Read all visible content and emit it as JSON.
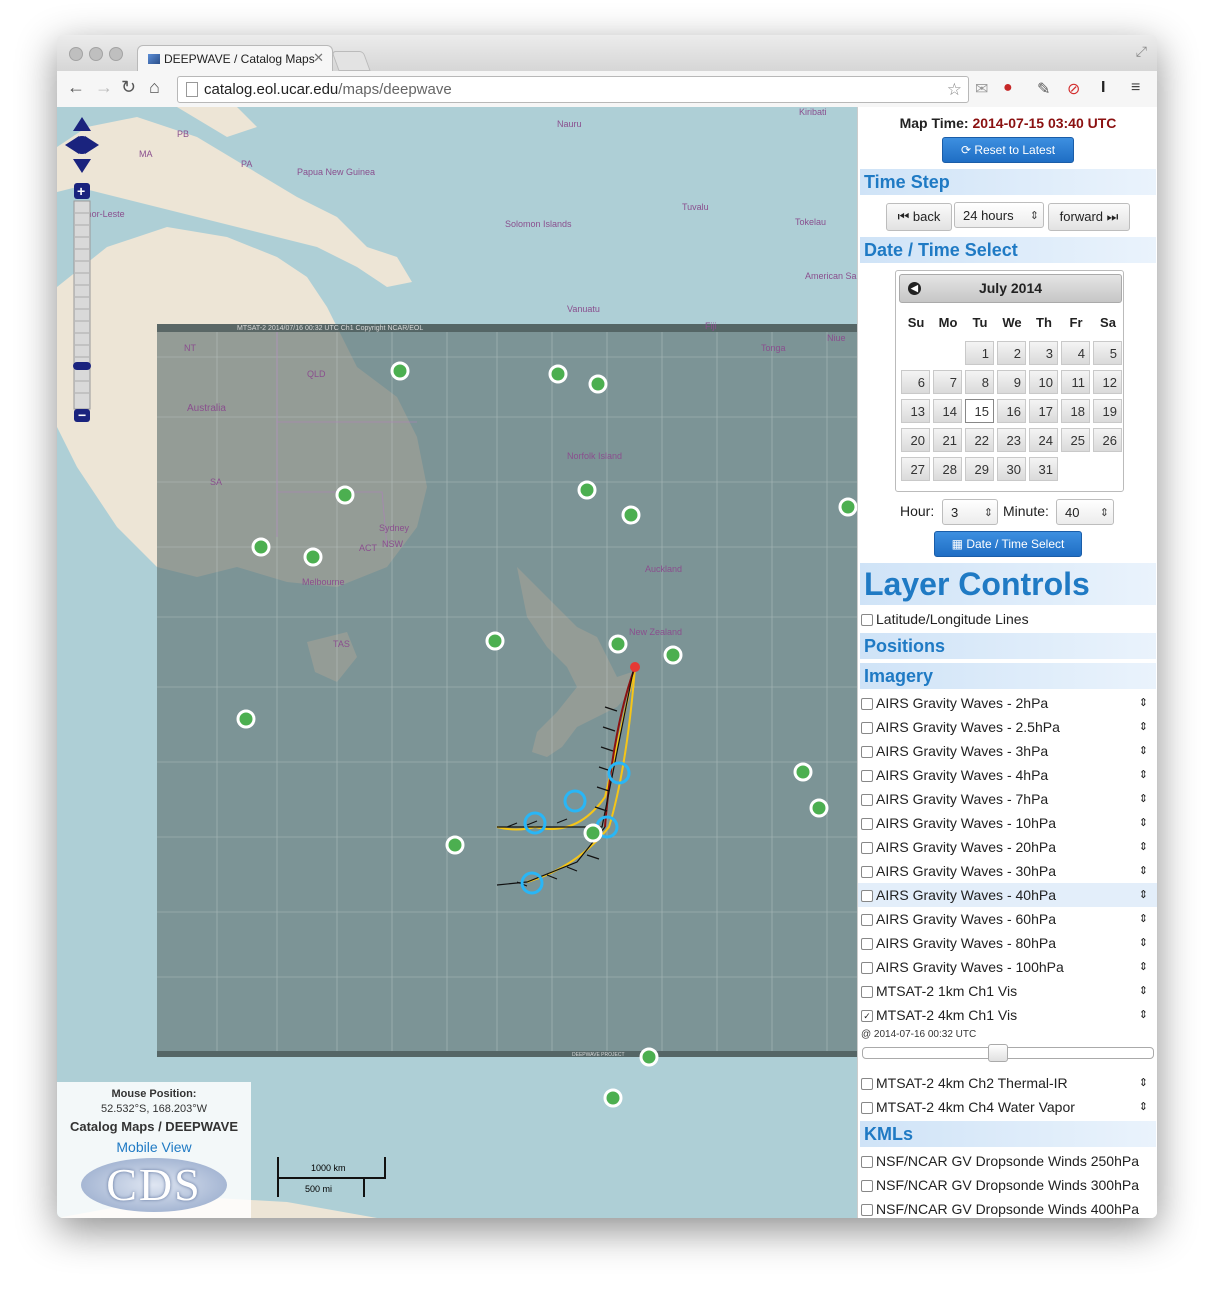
{
  "browser": {
    "tab_title": "DEEPWAVE / Catalog Maps",
    "url_host": "catalog.eol.ucar.edu",
    "url_path": "/maps/deepwave"
  },
  "map": {
    "place_labels": [
      {
        "name": "Nauru"
      },
      {
        "name": "Kiribati"
      },
      {
        "name": "PB"
      },
      {
        "name": "MA"
      },
      {
        "name": "PA"
      },
      {
        "name": "Papua New Guinea"
      },
      {
        "name": "Timor-Leste"
      },
      {
        "name": "Tuvalu"
      },
      {
        "name": "Solomon Islands"
      },
      {
        "name": "Tokelau"
      },
      {
        "name": "American Samoa"
      },
      {
        "name": "Vanuatu"
      },
      {
        "name": "Fiji"
      },
      {
        "name": "Tonga"
      },
      {
        "name": "Niue"
      },
      {
        "name": "NT"
      },
      {
        "name": "QLD"
      },
      {
        "name": "Australia"
      },
      {
        "name": "Norfolk Island"
      },
      {
        "name": "SA"
      },
      {
        "name": "Sydney"
      },
      {
        "name": "ACT"
      },
      {
        "name": "NSW"
      },
      {
        "name": "Melbourne"
      },
      {
        "name": "Auckland"
      },
      {
        "name": "New Zealand"
      },
      {
        "name": "TAS"
      }
    ],
    "overlay_header": "MTSAT-2 2014/07/16 00:32 UTC Ch1 Copyright NCAR/EOL",
    "overlay_footer": "DEEPWAVE PROJECT",
    "mouse_position_label": "Mouse Position:",
    "mouse_position_value": "52.532°S, 168.203°W",
    "legend_title": "Catalog Maps / DEEPWAVE",
    "mobile_view_link": "Mobile View",
    "logo_text": "CDS",
    "scale_km": "1000 km",
    "scale_mi": "500 mi"
  },
  "sidebar": {
    "map_time_label": "Map Time:",
    "map_time_value": "2014-07-15 03:40 UTC",
    "reset_button": "Reset to Latest",
    "time_step_header": "Time Step",
    "back_button": "back",
    "step_value": "24 hours",
    "forward_button": "forward",
    "date_time_header": "Date / Time Select",
    "calendar": {
      "month": "July 2014",
      "weekdays": [
        "Su",
        "Mo",
        "Tu",
        "We",
        "Th",
        "Fr",
        "Sa"
      ],
      "first_weekday_index": 2,
      "days_in_month": 31,
      "selected_day": 15
    },
    "hour_label": "Hour:",
    "hour_value": "3",
    "minute_label": "Minute:",
    "minute_value": "40",
    "date_select_button": "Date / Time Select",
    "layer_controls_header": "Layer Controls",
    "latlon_layer": "Latitude/Longitude Lines",
    "positions_header": "Positions",
    "imagery_header": "Imagery",
    "imagery_layers": [
      {
        "name": "AIRS Gravity Waves - 2hPa",
        "checked": false
      },
      {
        "name": "AIRS Gravity Waves - 2.5hPa",
        "checked": false
      },
      {
        "name": "AIRS Gravity Waves - 3hPa",
        "checked": false
      },
      {
        "name": "AIRS Gravity Waves - 4hPa",
        "checked": false
      },
      {
        "name": "AIRS Gravity Waves - 7hPa",
        "checked": false
      },
      {
        "name": "AIRS Gravity Waves - 10hPa",
        "checked": false
      },
      {
        "name": "AIRS Gravity Waves - 20hPa",
        "checked": false
      },
      {
        "name": "AIRS Gravity Waves - 30hPa",
        "checked": false
      },
      {
        "name": "AIRS Gravity Waves - 40hPa",
        "checked": false
      },
      {
        "name": "AIRS Gravity Waves - 60hPa",
        "checked": false
      },
      {
        "name": "AIRS Gravity Waves - 80hPa",
        "checked": false
      },
      {
        "name": "AIRS Gravity Waves - 100hPa",
        "checked": false
      },
      {
        "name": "MTSAT-2 1km Ch1 Vis",
        "checked": false
      },
      {
        "name": "MTSAT-2 4km Ch1 Vis",
        "checked": true
      }
    ],
    "opacity_timestamp": "@ 2014-07-16 00:32 UTC",
    "opacity_level": 0.46,
    "imagery_layers_2": [
      {
        "name": "MTSAT-2 4km Ch2 Thermal-IR",
        "checked": false
      },
      {
        "name": "MTSAT-2 4km Ch4 Water Vapor",
        "checked": false
      }
    ],
    "kmls_header": "KMLs",
    "kml_layers": [
      {
        "name": "NSF/NCAR GV Dropsonde Winds 250hPa",
        "checked": false
      },
      {
        "name": "NSF/NCAR GV Dropsonde Winds 300hPa",
        "checked": false
      },
      {
        "name": "NSF/NCAR GV Dropsonde Winds 400hPa",
        "checked": false
      }
    ]
  },
  "colors": {
    "accent": "#1f7ac4",
    "map_time": "#8b1111",
    "button_blue": "#2a7fd4",
    "station": "#4caf50"
  }
}
